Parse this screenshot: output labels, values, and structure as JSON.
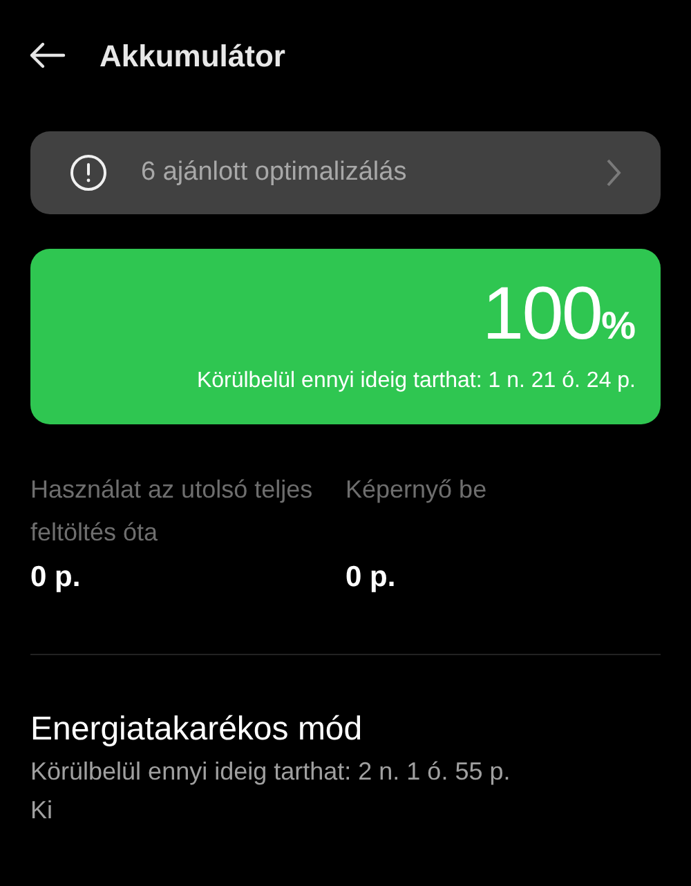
{
  "header": {
    "title": "Akkumulátor"
  },
  "optimization": {
    "label": "6 ajánlott optimalizálás"
  },
  "battery": {
    "percent": "100",
    "unit": "%",
    "estimate": "Körülbelül ennyi ideig tarthat: 1 n. 21 ó. 24 p."
  },
  "stats": [
    {
      "label": "Használat az utolsó teljes feltöltés óta",
      "value": "0 p."
    },
    {
      "label": "Képernyő be",
      "value": "0 p."
    }
  ],
  "power_saving": {
    "title": "Energiatakarékos mód",
    "estimate": "Körülbelül ennyi ideig tarthat: 2 n. 1 ó. 55 p.",
    "status": "Ki"
  }
}
